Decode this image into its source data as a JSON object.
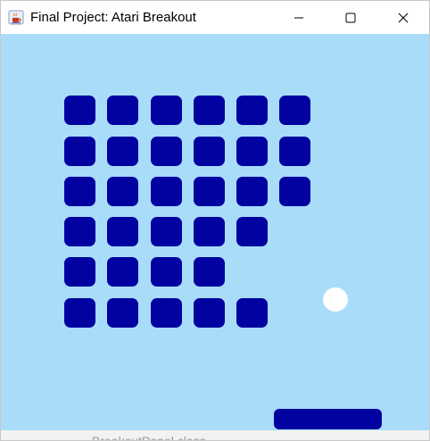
{
  "window": {
    "title": "Final Project: Atari Breakout",
    "app_icon": "java-coffee-cup-icon",
    "controls": {
      "minimize_icon": "minimize-icon",
      "maximize_icon": "maximize-icon",
      "close_icon": "close-icon"
    }
  },
  "game": {
    "background_color": "#a9dcf9",
    "brick_color": "#0202a1",
    "paddle_color": "#0202a1",
    "ball_color": "#ffffff",
    "brick_rows": [
      [
        true,
        true,
        true,
        true,
        true,
        true
      ],
      [
        true,
        true,
        true,
        true,
        true,
        true
      ],
      [
        true,
        true,
        true,
        true,
        true,
        true
      ],
      [
        true,
        true,
        true,
        true,
        true,
        false
      ],
      [
        true,
        true,
        true,
        true,
        false,
        false
      ],
      [
        true,
        true,
        true,
        true,
        true,
        false
      ]
    ]
  },
  "background_window": {
    "partial_text": "BreakoutPanel.class"
  }
}
